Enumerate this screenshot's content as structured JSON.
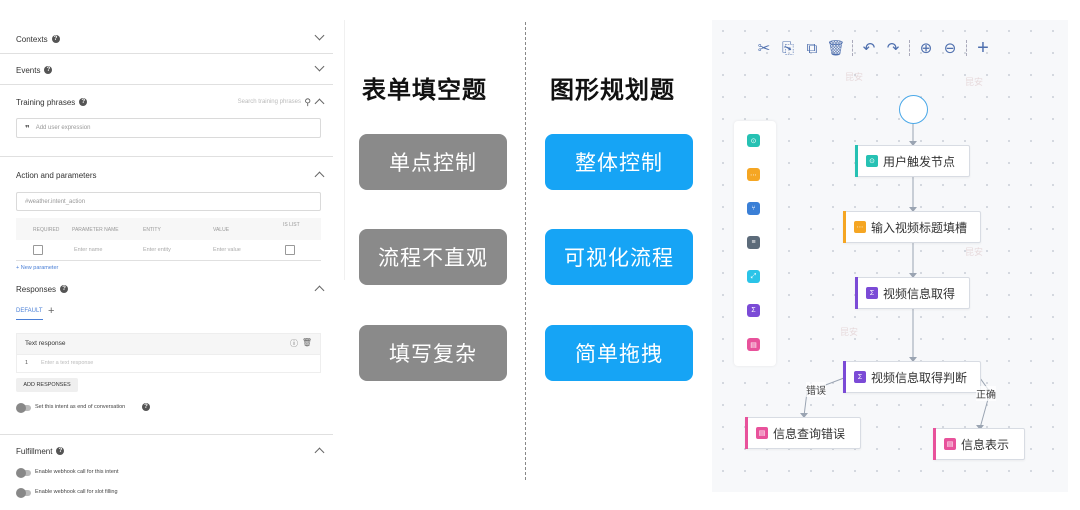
{
  "form": {
    "contexts_label": "Contexts",
    "events_label": "Events",
    "training_phrases_label": "Training phrases",
    "search_placeholder": "Search training phrases",
    "user_expression_placeholder": "Add user expression",
    "action_params_label": "Action and parameters",
    "action_value": "#weather.intent_action",
    "columns": [
      "REQUIRED",
      "PARAMETER NAME",
      "ENTITY",
      "VALUE",
      "IS LIST"
    ],
    "row_placeholders": [
      "Enter name",
      "Enter entity",
      "Enter value"
    ],
    "new_parameter": "+ New parameter",
    "responses_label": "Responses",
    "default_tab": "DEFAULT",
    "add_tab": "+",
    "text_response_label": "Text response",
    "response_index": "1",
    "text_response_placeholder": "Enter a text response",
    "add_responses": "ADD RESPONSES",
    "end_conversation": "Set this intent as end of conversation",
    "fulfillment_label": "Fulfillment",
    "webhook_intent": "Enable webhook call for this intent",
    "webhook_slot": "Enable webhook call for slot filling"
  },
  "compare": {
    "left_title": "表单填空题",
    "right_title": "图形规划题",
    "left_items": [
      "单点控制",
      "流程不直观",
      "填写复杂"
    ],
    "right_items": [
      "整体控制",
      "可视化流程",
      "简单拖拽"
    ]
  },
  "flow": {
    "toolbar": [
      "scissors-icon",
      "copy-icon",
      "paste-icon",
      "delete-icon",
      "undo-icon",
      "redo-icon",
      "zoom-in-icon",
      "zoom-out-icon",
      "add-icon"
    ],
    "nodes": {
      "trigger": "用户触发节点",
      "input_title": "输入视频标题填槽",
      "video_info": "视频信息取得",
      "video_judge": "视频信息取得判断",
      "info_error": "信息查询错误",
      "info_display": "信息表示"
    },
    "edge_labels": {
      "error": "错误",
      "correct": "正确"
    },
    "colors": {
      "teal": "#26c1b3",
      "orange": "#f5a623",
      "purple": "#7b4bd6",
      "pink": "#e8529b",
      "blue": "#3a7fd6",
      "gray": "#5c6b7a",
      "cyan": "#2bc4e8"
    }
  }
}
